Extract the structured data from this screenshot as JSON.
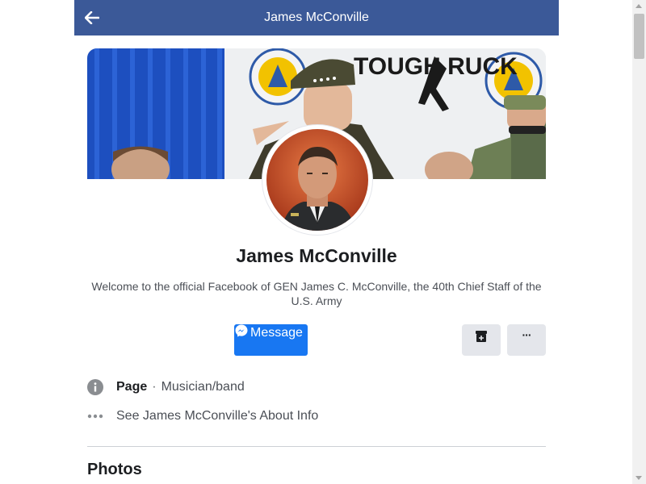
{
  "header": {
    "title": "James McConville"
  },
  "profile": {
    "name": "James McConville",
    "bio": "Welcome to the official Facebook of GEN James C. McConville, the 40th Chief Staff of the U.S. Army"
  },
  "actions": {
    "message_label": "Message",
    "more_label": "···"
  },
  "info": {
    "page_label": "Page",
    "separator": "·",
    "category": "Musician/band",
    "about_link": "See James McConville's About Info"
  },
  "sections": {
    "photos_title": "Photos"
  },
  "colors": {
    "header_bg": "#3b5998",
    "primary_button": "#1877f2",
    "secondary_button": "#e4e6eb"
  },
  "cover": {
    "banner_text": "TOUGH RUCK"
  }
}
